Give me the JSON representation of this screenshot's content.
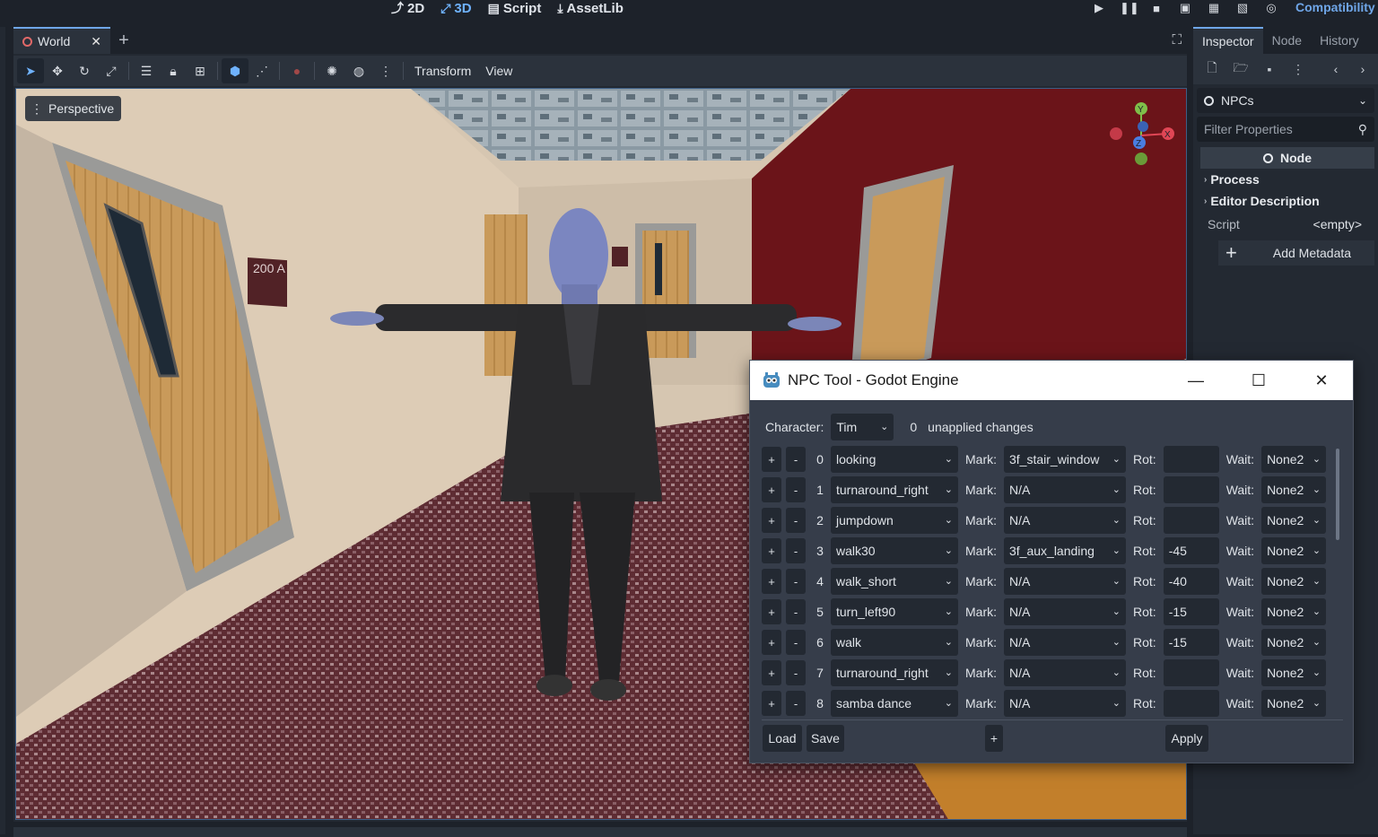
{
  "workspaces": [
    {
      "label": "2D",
      "icon": "2d-icon"
    },
    {
      "label": "3D",
      "icon": "3d-icon"
    },
    {
      "label": "Script",
      "icon": "script-icon"
    },
    {
      "label": "AssetLib",
      "icon": "assetlib-icon"
    }
  ],
  "renderer": "Compatibility",
  "scene_tab": {
    "title": "World"
  },
  "toolbar": {
    "transform": "Transform",
    "view": "View"
  },
  "viewport": {
    "perspective": "Perspective",
    "gizmo": {
      "y": "Y",
      "x": "X",
      "z": "Z"
    },
    "sign_text": "200 A"
  },
  "dock": {
    "tabs": [
      "Inspector",
      "Node",
      "History"
    ],
    "node_name": "NPCs",
    "filter_placeholder": "Filter Properties",
    "section": "Node",
    "groups": [
      "Process",
      "Editor Description"
    ],
    "script_label": "Script",
    "script_value": "<empty>",
    "add_metadata": "Add Metadata"
  },
  "npc_tool": {
    "title": "NPC Tool - Godot Engine",
    "character_label": "Character:",
    "character_value": "Tim",
    "unapplied_count": "0",
    "unapplied_text": "unapplied changes",
    "mark_label": "Mark:",
    "rot_label": "Rot:",
    "wait_label": "Wait:",
    "rows": [
      {
        "index": "0",
        "anim": "looking",
        "mark": "3f_stair_window",
        "rot": "",
        "wait": "None2"
      },
      {
        "index": "1",
        "anim": "turnaround_right",
        "mark": "N/A",
        "rot": "",
        "wait": "None2"
      },
      {
        "index": "2",
        "anim": "jumpdown",
        "mark": "N/A",
        "rot": "",
        "wait": "None2"
      },
      {
        "index": "3",
        "anim": "walk30",
        "mark": "3f_aux_landing",
        "rot": "-45",
        "wait": "None2"
      },
      {
        "index": "4",
        "anim": "walk_short",
        "mark": "N/A",
        "rot": "-40",
        "wait": "None2"
      },
      {
        "index": "5",
        "anim": "turn_left90",
        "mark": "N/A",
        "rot": "-15",
        "wait": "None2"
      },
      {
        "index": "6",
        "anim": "walk",
        "mark": "N/A",
        "rot": "-15",
        "wait": "None2"
      },
      {
        "index": "7",
        "anim": "turnaround_right",
        "mark": "N/A",
        "rot": "",
        "wait": "None2"
      },
      {
        "index": "8",
        "anim": "samba dance",
        "mark": "N/A",
        "rot": "",
        "wait": "None2"
      }
    ],
    "load": "Load",
    "save": "Save",
    "add": "+",
    "apply": "Apply"
  }
}
